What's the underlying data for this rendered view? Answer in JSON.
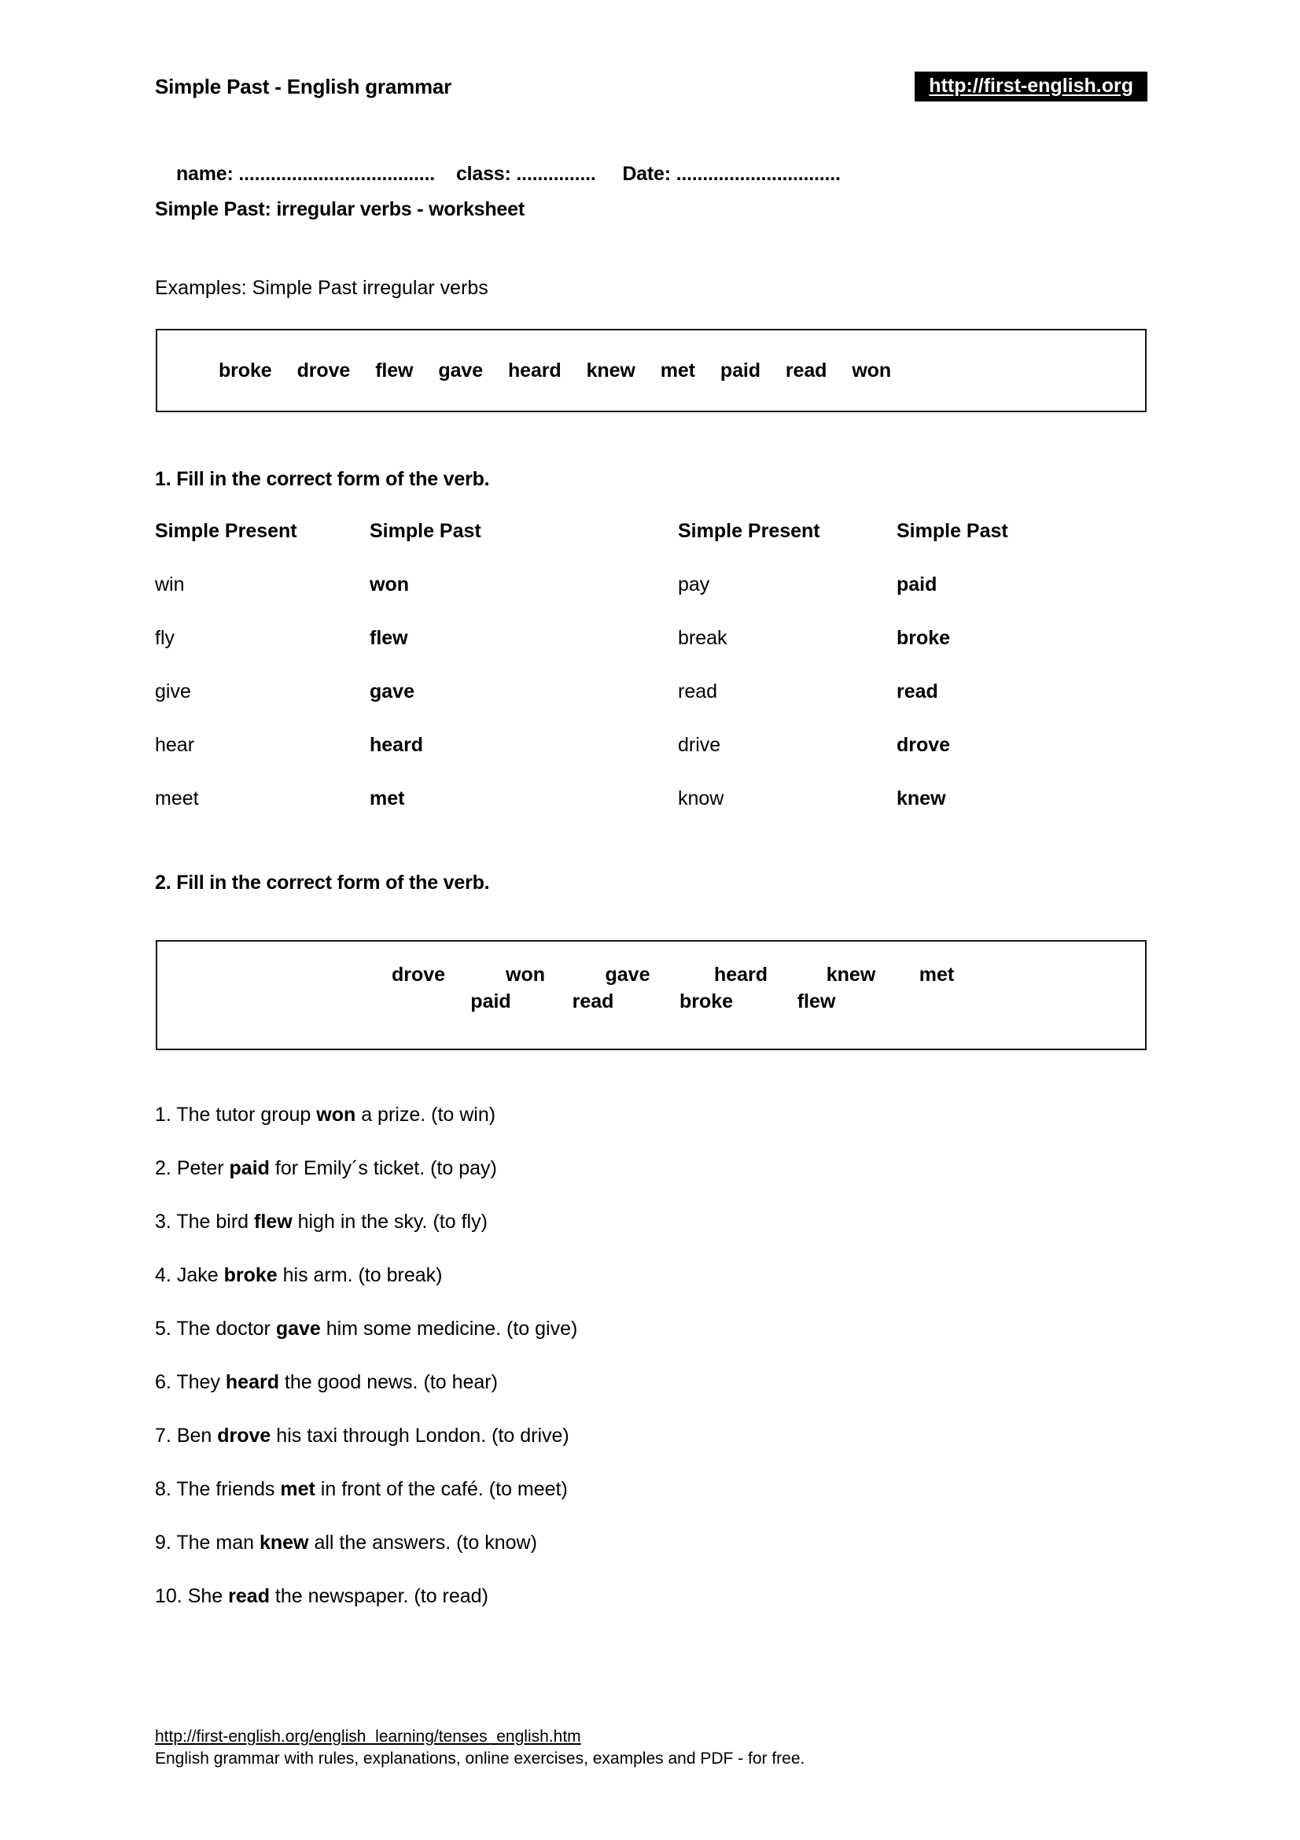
{
  "header": {
    "title": "Simple Past - English grammar",
    "site_url": "http://first-english.org",
    "name_label": "name: .....................................",
    "class_label": "class: ...............",
    "date_label": "Date: ...............................",
    "subtitle": "Simple Past: irregular verbs - worksheet"
  },
  "examples": {
    "label": "Examples: Simple Past irregular verbs",
    "words": [
      "broke",
      "drove",
      "flew",
      "gave",
      "heard",
      "knew",
      "met",
      "paid",
      "read",
      "won"
    ]
  },
  "exercise1": {
    "heading": "1. Fill in the correct form of the verb.",
    "columns": [
      "Simple Present",
      "Simple Past",
      "Simple Present",
      "Simple Past"
    ],
    "rows": [
      {
        "present_left": "win",
        "past_left": "won",
        "present_right": "pay",
        "past_right": "paid"
      },
      {
        "present_left": "fly",
        "past_left": "flew",
        "present_right": "break",
        "past_right": "broke"
      },
      {
        "present_left": "give",
        "past_left": "gave",
        "present_right": "read",
        "past_right": "read"
      },
      {
        "present_left": "hear",
        "past_left": "heard",
        "present_right": "drive",
        "past_right": "drove"
      },
      {
        "present_left": "meet",
        "past_left": "met",
        "present_right": "know",
        "past_right": "knew"
      }
    ]
  },
  "exercise2": {
    "heading": "2. Fill in the correct form of the verb.",
    "wordbank_row1": [
      "drove",
      "won",
      "gave",
      "heard",
      "knew",
      "met"
    ],
    "wordbank_row2": [
      "paid",
      "read",
      "broke",
      "flew"
    ],
    "sentences": [
      {
        "number": "1.",
        "before": "The tutor group ",
        "answer": "won",
        "after": " a prize. (to win)"
      },
      {
        "number": "2.",
        "before": "Peter  ",
        "answer": "paid",
        "after": " for Emily´s ticket. (to pay)"
      },
      {
        "number": "3.",
        "before": "The bird ",
        "answer": "flew",
        "after": " high in the sky. (to fly)"
      },
      {
        "number": "4.",
        "before": "Jake ",
        "answer": "broke",
        "after": "  his arm. (to break)"
      },
      {
        "number": "5.",
        "before": "The doctor ",
        "answer": "gave",
        "after": " him some medicine. (to give)"
      },
      {
        "number": "6.",
        "before": "They  ",
        "answer": "heard",
        "after": "  the good news. (to hear)"
      },
      {
        "number": "7.",
        "before": "Ben  ",
        "answer": "drove",
        "after": "  his taxi through London. (to drive)"
      },
      {
        "number": "8.",
        "before": "The friends  ",
        "answer": "met",
        "after": "  in front of the café. (to meet)"
      },
      {
        "number": "9.",
        "before": "The man ",
        "answer": "knew",
        "after": " all the answers. (to know)"
      },
      {
        "number": "10.",
        "before": "She ",
        "answer": "read",
        "after": "  the newspaper. (to read)"
      }
    ]
  },
  "footer": {
    "url": "http://first-english.org/english_learning/tenses_english.htm",
    "description": "English grammar with rules, explanations, online exercises, examples and PDF - for free."
  }
}
